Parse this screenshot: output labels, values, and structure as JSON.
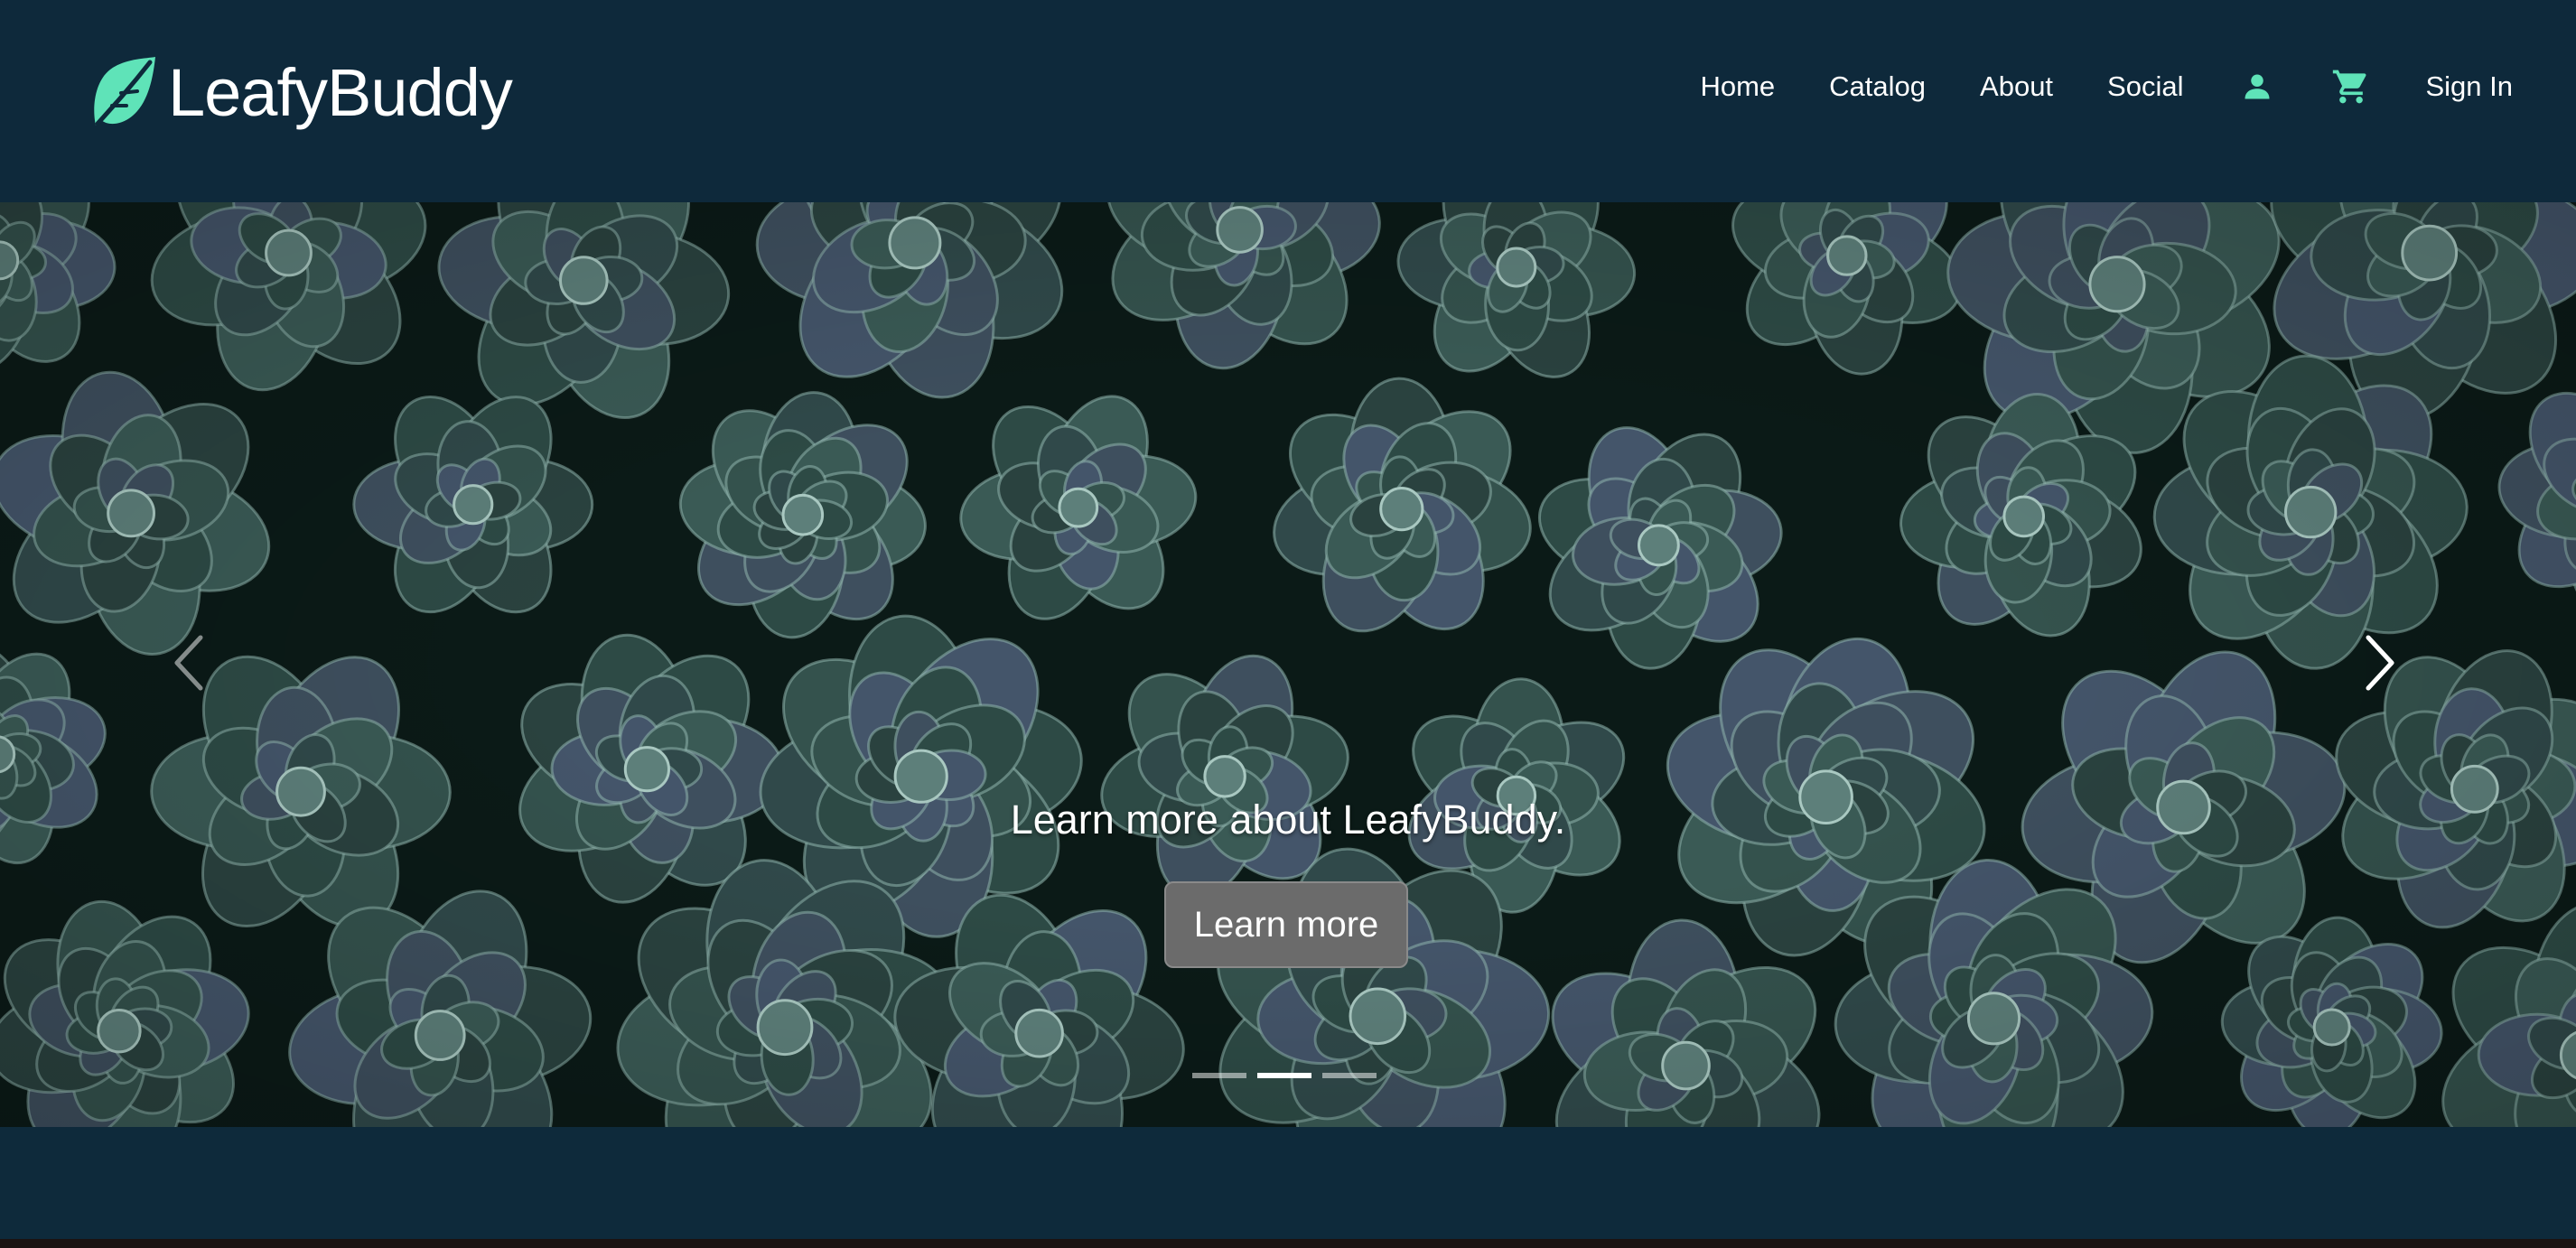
{
  "brand": {
    "name": "LeafyBuddy",
    "logo_icon": "leaf-icon"
  },
  "nav": {
    "links": [
      "Home",
      "Catalog",
      "About",
      "Social"
    ],
    "account_icon": "account-icon",
    "cart_icon": "shopping-cart-icon",
    "signin_label": "Sign In"
  },
  "hero": {
    "image": "succulent plants close-up",
    "caption": "Learn more about LeafyBuddy.",
    "button_label": "Learn more",
    "slide_count": 3,
    "active_slide": 2,
    "prev_icon": "chevron-left-icon",
    "next_icon": "chevron-right-icon"
  },
  "colors": {
    "background": "#0e2a3b",
    "accent": "#5fe3b8",
    "text": "#ffffff",
    "button": "#6b6b6b"
  }
}
